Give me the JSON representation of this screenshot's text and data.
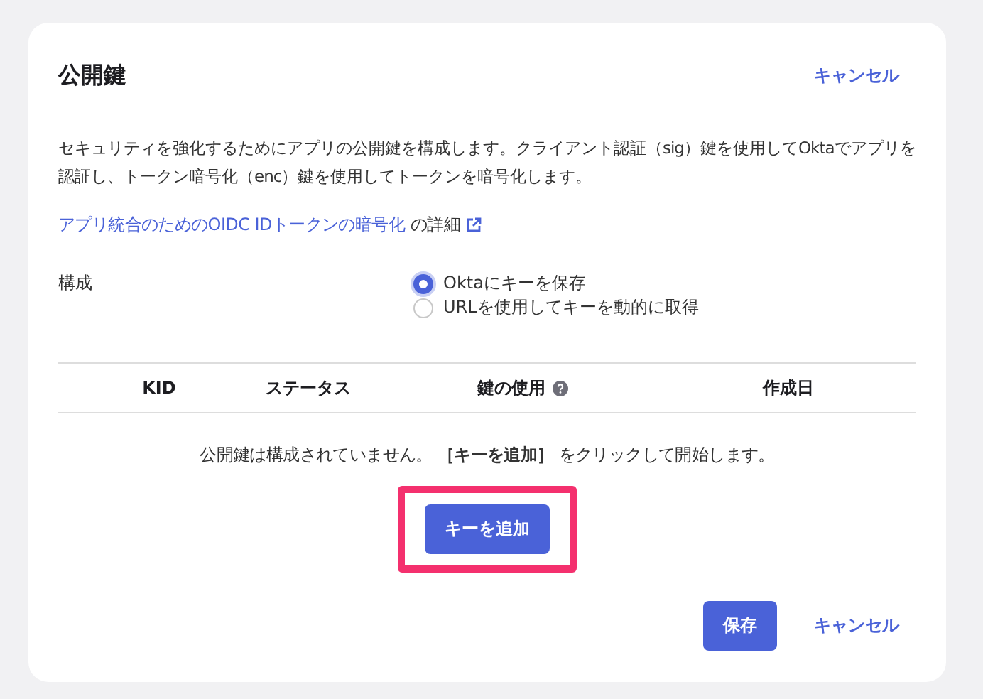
{
  "header": {
    "title": "公開鍵",
    "cancel": "キャンセル"
  },
  "description": "セキュリティを強化するためにアプリの公開鍵を構成します。クライアント認証（sig）鍵を使用してOktaでアプリを認証し、トークン暗号化（enc）鍵を使用してトークンを暗号化します。",
  "learn_more": {
    "link": "アプリ統合のためのOIDC IDトークンの暗号化",
    "suffix": "の詳細"
  },
  "configuration": {
    "label": "構成",
    "options": [
      {
        "label": "Oktaにキーを保存",
        "selected": true
      },
      {
        "label": "URLを使用してキーを動的に取得",
        "selected": false
      }
    ]
  },
  "table": {
    "columns": [
      {
        "label": "KID",
        "help": false
      },
      {
        "label": "ステータス",
        "help": false
      },
      {
        "label": "鍵の使用",
        "help": true
      },
      {
        "label": "作成日",
        "help": false
      }
    ],
    "empty_message": "公開鍵は構成されていません。 **［キーを追加］** をクリックして開始します。"
  },
  "add_key": {
    "label": "キーを追加",
    "highlighted": true
  },
  "footer": {
    "save": "保存",
    "cancel": "キャンセル"
  }
}
